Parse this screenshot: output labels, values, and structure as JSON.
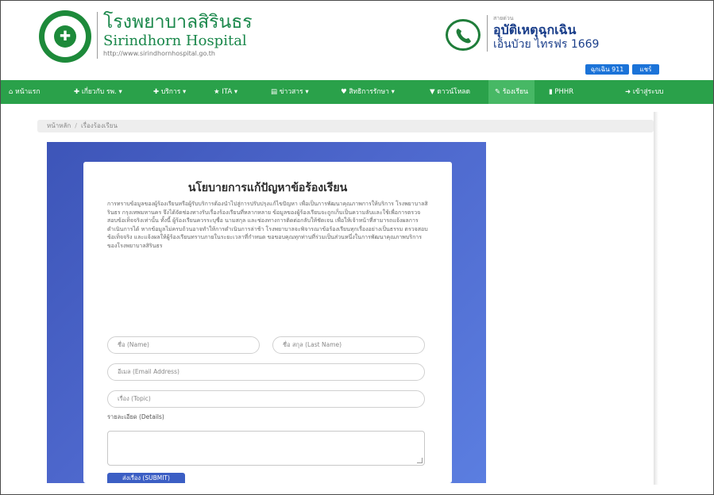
{
  "header": {
    "title_th": "โรงพยาบาลสิรินธร",
    "title_en": "Sirindhorn Hospital",
    "url": "http://www.sirindhornhospital.go.th",
    "emergency": {
      "small": "สายด่วน",
      "title": "อุบัติเหตุฉุกเฉิน",
      "subtitle": "เอ็นบัวย ไทรฟร 1669"
    },
    "buttons": [
      "ฉุกเฉิน 911",
      "แชร์"
    ]
  },
  "nav": {
    "items": [
      {
        "icon": "home-icon",
        "label": "หน้าแรก"
      },
      {
        "icon": "info-icon",
        "label": "เกี่ยวกับ รพ. ▾"
      },
      {
        "icon": "service-icon",
        "label": "บริการ ▾"
      },
      {
        "icon": "star-icon",
        "label": "ITA ▾"
      },
      {
        "icon": "news-icon",
        "label": "ข่าวสาร ▾"
      },
      {
        "icon": "heart-icon",
        "label": "สิทธิการรักษา ▾"
      },
      {
        "icon": "file-icon",
        "label": "ดาวน์โหลด"
      },
      {
        "icon": "pencil-icon",
        "label": "ร้องเรียน"
      },
      {
        "icon": "chart-icon",
        "label": "PHHR"
      },
      {
        "icon": "login-icon",
        "label": "เข้าสู่ระบบ"
      }
    ],
    "active_index": 7
  },
  "breadcrumb": {
    "home": "หน้าหลัก",
    "current": "เรื่องร้องเรียน"
  },
  "policy": {
    "title": "นโยบายการแก้ปัญหาข้อร้องเรียน",
    "body": "การทราบข้อมูลของผู้ร้องเรียนหรือผู้รับบริการต้องนำไปสู่การปรับปรุงแก้ไขปัญหา เพื่อเป็นการพัฒนาคุณภาพการให้บริการ โรงพยาบาลสิรินธร กรุงเทพมหานคร จึงได้จัดช่องทางรับเรื่องร้องเรียนที่หลากหลาย ข้อมูลของผู้ร้องเรียนจะถูกเก็บเป็นความลับและใช้เพื่อการตรวจสอบข้อเท็จจริงเท่านั้น ทั้งนี้ ผู้ร้องเรียนควรระบุชื่อ นามสกุล และช่องทางการติดต่อกลับให้ชัดเจน เพื่อให้เจ้าหน้าที่สามารถแจ้งผลการดำเนินการได้ หากข้อมูลไม่ครบถ้วนอาจทำให้การดำเนินการล่าช้า โรงพยาบาลจะพิจารณาข้อร้องเรียนทุกเรื่องอย่างเป็นธรรม ตรวจสอบข้อเท็จจริง และแจ้งผลให้ผู้ร้องเรียนทราบภายในระยะเวลาที่กำหนด ขอขอบคุณทุกท่านที่ร่วมเป็นส่วนหนึ่งในการพัฒนาคุณภาพบริการของโรงพยาบาลสิรินธร"
  },
  "form": {
    "first_name_placeholder": "ชื่อ (Name)",
    "last_name_placeholder": "ชื่อ สกุล (Last Name)",
    "email_placeholder": "อีเมล (Email Address)",
    "subject_placeholder": "เรื่อง (Topic)",
    "detail_label": "รายละเอียด (Details)",
    "submit_label": "ส่งเรื่อง (SUBMIT)"
  },
  "colors": {
    "nav_green": "#2aa14a",
    "brand_green": "#19874a",
    "hero_blue": "#4d67cc",
    "button_blue": "#1b73d8"
  }
}
